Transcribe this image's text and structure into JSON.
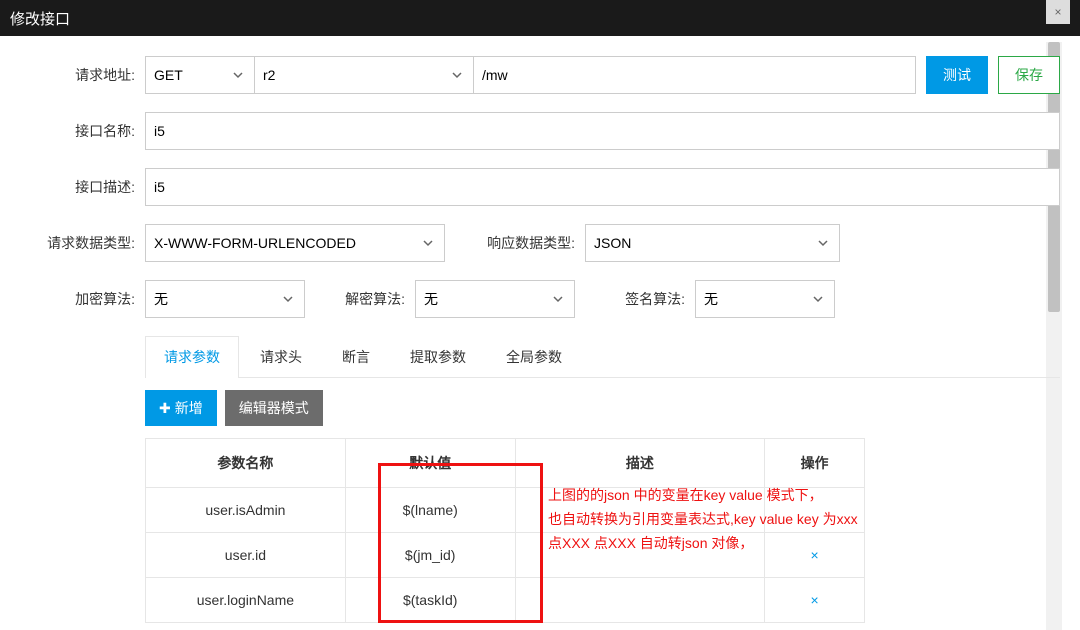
{
  "topbar": {
    "title": "修改接口"
  },
  "labels": {
    "url": "请求地址:",
    "name": "接口名称:",
    "desc": "接口描述:",
    "reqType": "请求数据类型:",
    "resType": "响应数据类型:",
    "encrypt": "加密算法:",
    "decrypt": "解密算法:",
    "sign": "签名算法:"
  },
  "form": {
    "method": "GET",
    "host": "r2",
    "path": "/mw",
    "name": "i5",
    "desc": "i5",
    "reqType": "X-WWW-FORM-URLENCODED",
    "resType": "JSON",
    "encrypt": "无",
    "decrypt": "无",
    "sign": "无"
  },
  "buttons": {
    "test": "测试",
    "save": "保存",
    "add": "新增",
    "editor": "编辑器模式"
  },
  "tabs": [
    "请求参数",
    "请求头",
    "断言",
    "提取参数",
    "全局参数"
  ],
  "table": {
    "headers": [
      "参数名称",
      "默认值",
      "描述",
      "操作"
    ],
    "rows": [
      {
        "name": "user.isAdmin",
        "value": "$(lname)",
        "desc": "",
        "op": ""
      },
      {
        "name": "user.id",
        "value": "$(jm_id)",
        "desc": "",
        "op": "×"
      },
      {
        "name": "user.loginName",
        "value": "$(taskId)",
        "desc": "",
        "op": "×"
      }
    ]
  },
  "annotation": {
    "line1": "上图的的json 中的变量在key value 模式下，",
    "line2": "也自动转换为引用变量表达式,key value key 为xxx",
    "line3": "点XXX 点XXX 自动转json 对像，"
  }
}
